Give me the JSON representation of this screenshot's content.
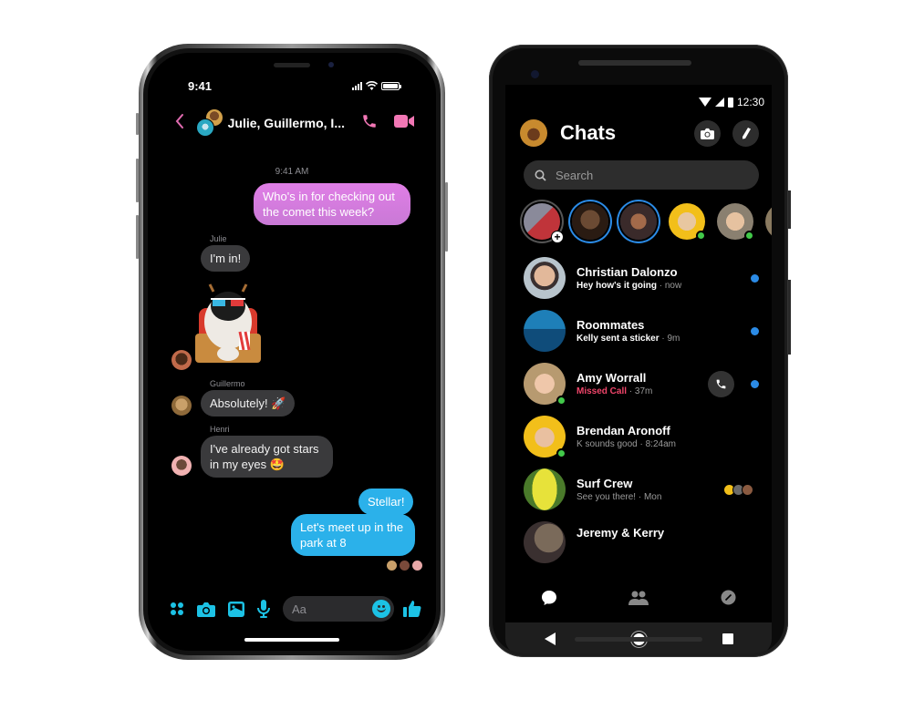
{
  "iphone": {
    "status_time": "9:41",
    "header": {
      "title": "Julie, Guillermo, I...",
      "back_icon": "chevron-left-icon",
      "call_icon": "phone-icon",
      "video_icon": "video-camera-icon"
    },
    "timestamp": "9:41 AM",
    "messages": [
      {
        "sender": "",
        "text": "Who's in for checking out the comet this week?",
        "direction": "outgoing"
      },
      {
        "sender": "Julie",
        "text": "I'm in!",
        "direction": "incoming"
      },
      {
        "sender": "Julie",
        "text": "",
        "type": "sticker",
        "sticker": "yeti-popcorn-3d-glasses",
        "direction": "incoming"
      },
      {
        "sender": "Guillermo",
        "text": "Absolutely! 🚀",
        "direction": "incoming"
      },
      {
        "sender": "Henri",
        "text": "I've already got stars in my eyes 🤩",
        "direction": "incoming"
      },
      {
        "sender": "",
        "text": "Stellar!",
        "direction": "outgoing"
      },
      {
        "sender": "",
        "text": "Let's meet up in the park at 8",
        "direction": "outgoing"
      }
    ],
    "composer": {
      "placeholder": "Aa",
      "icons": [
        "apps-grid-icon",
        "camera-icon",
        "gallery-icon",
        "microphone-icon",
        "emoji-icon",
        "thumbs-up-icon"
      ]
    },
    "colors": {
      "accent_pink": "#f277b5",
      "accent_blue": "#1cc2e5",
      "bubble_pink": "#d77bdf",
      "bubble_blue": "#2bb1ea",
      "bubble_gray": "#3a3a3c"
    }
  },
  "android": {
    "status_time": "12:30",
    "title": "Chats",
    "search_placeholder": "Search",
    "stories": [
      {
        "name": "your-story",
        "ring": "gray",
        "add": true
      },
      {
        "name": "story-2",
        "ring": "blue"
      },
      {
        "name": "story-3",
        "ring": "blue"
      },
      {
        "name": "active-4",
        "online": true
      },
      {
        "name": "active-5",
        "online": true
      }
    ],
    "conversations": [
      {
        "name": "Christian Dalonzo",
        "preview": "Hey how's it going",
        "time": "now",
        "unread": true,
        "bold_preview": true
      },
      {
        "name": "Roommates",
        "preview": "Kelly sent a sticker",
        "time": "9m",
        "unread": true,
        "bold_preview": true
      },
      {
        "name": "Amy Worrall",
        "preview": "Missed Call",
        "time": "37m",
        "unread": true,
        "missed_call": true,
        "online": true,
        "call_button": true
      },
      {
        "name": "Brendan Aronoff",
        "preview": "K sounds good",
        "time": "8:24am",
        "online": true
      },
      {
        "name": "Surf Crew",
        "preview": "See you there!",
        "time": "Mon",
        "seen_by": 3
      },
      {
        "name": "Jeremy & Kerry",
        "preview": "",
        "time": ""
      }
    ],
    "separator": " · ",
    "tabs": [
      "chats-tab",
      "people-tab",
      "discover-tab"
    ],
    "colors": {
      "unread": "#2b8be6",
      "missed": "#f0456a",
      "online": "#42c94a"
    }
  }
}
